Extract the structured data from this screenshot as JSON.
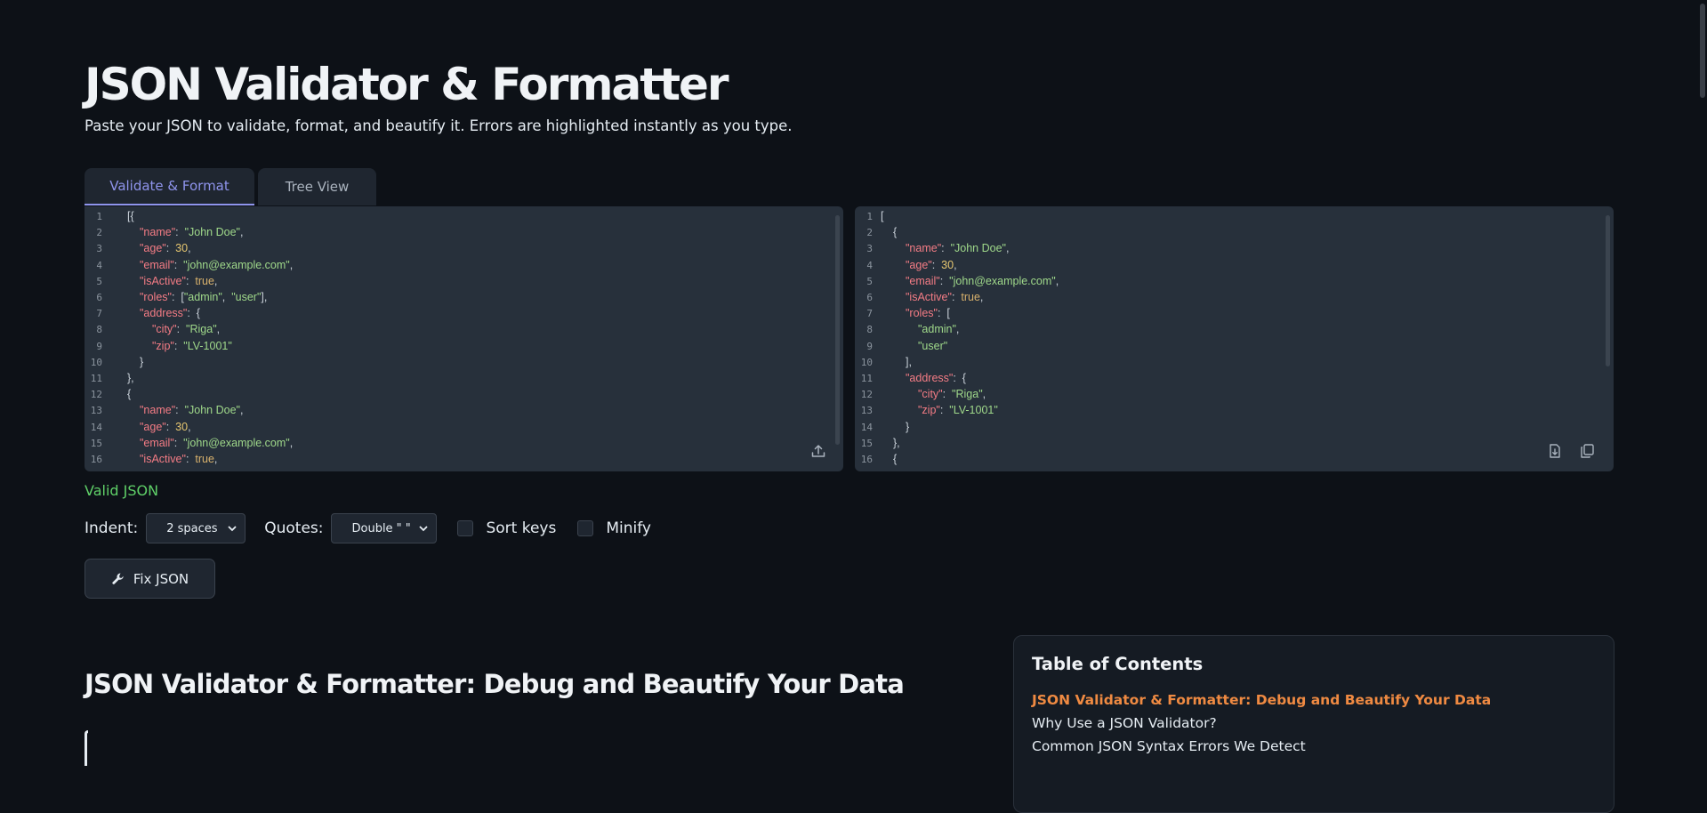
{
  "header": {
    "title": "JSON Validator & Formatter",
    "subtitle": "Paste your JSON to validate, format, and beautify it. Errors are highlighted instantly as you type."
  },
  "tabs": [
    {
      "label": "Validate & Format",
      "active": true
    },
    {
      "label": "Tree View",
      "active": false
    }
  ],
  "status": {
    "text": "Valid JSON",
    "color": "#5fd068"
  },
  "options": {
    "indent_label": "Indent:",
    "indent_value": "2 spaces",
    "quotes_label": "Quotes:",
    "quotes_value": "Double \" \"",
    "sort_keys_label": "Sort keys",
    "minify_label": "Minify"
  },
  "fix_button": {
    "label": "Fix JSON",
    "icon": "wrench-icon"
  },
  "section_heading": "JSON Validator & Formatter: Debug and Beautify Your Data",
  "toc": {
    "title": "Table of Contents",
    "items": [
      {
        "label": "JSON Validator & Formatter: Debug and Beautify Your Data",
        "active": true
      },
      {
        "label": "Why Use a JSON Validator?",
        "active": false
      },
      {
        "label": "Common JSON Syntax Errors We Detect",
        "active": false
      }
    ]
  },
  "input_editor": {
    "line_numbers": [
      "1",
      "2",
      "3",
      "4",
      "5",
      "6",
      "7",
      "8",
      "9",
      "10",
      "11",
      "12",
      "13",
      "14",
      "15",
      "16"
    ],
    "lines": [
      [
        {
          "t": "p",
          "v": "[{"
        }
      ],
      [
        {
          "t": "k",
          "v": "\"name\""
        },
        {
          "t": "p",
          "v": ":  "
        },
        {
          "t": "s",
          "v": "\"John Doe\""
        },
        {
          "t": "p",
          "v": ","
        }
      ],
      [
        {
          "t": "k",
          "v": "\"age\""
        },
        {
          "t": "p",
          "v": ":  "
        },
        {
          "t": "n",
          "v": "30"
        },
        {
          "t": "p",
          "v": ","
        }
      ],
      [
        {
          "t": "k",
          "v": "\"email\""
        },
        {
          "t": "p",
          "v": ":  "
        },
        {
          "t": "s",
          "v": "\"john@example.com\""
        },
        {
          "t": "p",
          "v": ","
        }
      ],
      [
        {
          "t": "k",
          "v": "\"isActive\""
        },
        {
          "t": "p",
          "v": ":  "
        },
        {
          "t": "b",
          "v": "true"
        },
        {
          "t": "p",
          "v": ","
        }
      ],
      [
        {
          "t": "k",
          "v": "\"roles\""
        },
        {
          "t": "p",
          "v": ":  ["
        },
        {
          "t": "s",
          "v": "\"admin\""
        },
        {
          "t": "p",
          "v": ",  "
        },
        {
          "t": "s",
          "v": "\"user\""
        },
        {
          "t": "p",
          "v": "],"
        }
      ],
      [
        {
          "t": "k",
          "v": "\"address\""
        },
        {
          "t": "p",
          "v": ":  {"
        }
      ],
      [
        {
          "t": "k",
          "v": "\"city\""
        },
        {
          "t": "p",
          "v": ":  "
        },
        {
          "t": "s",
          "v": "\"Riga\""
        },
        {
          "t": "p",
          "v": ","
        }
      ],
      [
        {
          "t": "k",
          "v": "\"zip\""
        },
        {
          "t": "p",
          "v": ":  "
        },
        {
          "t": "s",
          "v": "\"LV-1001\""
        }
      ],
      [
        {
          "t": "p",
          "v": "}"
        }
      ],
      [
        {
          "t": "p",
          "v": "},"
        }
      ],
      [
        {
          "t": "p",
          "v": "{"
        }
      ],
      [
        {
          "t": "k",
          "v": "\"name\""
        },
        {
          "t": "p",
          "v": ":  "
        },
        {
          "t": "s",
          "v": "\"John Doe\""
        },
        {
          "t": "p",
          "v": ","
        }
      ],
      [
        {
          "t": "k",
          "v": "\"age\""
        },
        {
          "t": "p",
          "v": ":  "
        },
        {
          "t": "n",
          "v": "30"
        },
        {
          "t": "p",
          "v": ","
        }
      ],
      [
        {
          "t": "k",
          "v": "\"email\""
        },
        {
          "t": "p",
          "v": ":  "
        },
        {
          "t": "s",
          "v": "\"john@example.com\""
        },
        {
          "t": "p",
          "v": ","
        }
      ],
      [
        {
          "t": "k",
          "v": "\"isActive\""
        },
        {
          "t": "p",
          "v": ":  "
        },
        {
          "t": "b",
          "v": "true"
        },
        {
          "t": "p",
          "v": ","
        }
      ]
    ],
    "indent_levels": [
      0,
      1,
      1,
      1,
      1,
      1,
      1,
      2,
      2,
      1,
      0,
      0,
      1,
      1,
      1,
      1
    ],
    "actions": [
      {
        "icon": "upload-icon"
      }
    ]
  },
  "output_editor": {
    "line_numbers": [
      "1",
      "2",
      "3",
      "4",
      "5",
      "6",
      "7",
      "8",
      "9",
      "10",
      "11",
      "12",
      "13",
      "14",
      "15",
      "16"
    ],
    "lines": [
      [
        {
          "t": "p",
          "v": "["
        }
      ],
      [
        {
          "t": "p",
          "v": "{"
        }
      ],
      [
        {
          "t": "k",
          "v": "\"name\""
        },
        {
          "t": "p",
          "v": ":  "
        },
        {
          "t": "s",
          "v": "\"John Doe\""
        },
        {
          "t": "p",
          "v": ","
        }
      ],
      [
        {
          "t": "k",
          "v": "\"age\""
        },
        {
          "t": "p",
          "v": ":  "
        },
        {
          "t": "n",
          "v": "30"
        },
        {
          "t": "p",
          "v": ","
        }
      ],
      [
        {
          "t": "k",
          "v": "\"email\""
        },
        {
          "t": "p",
          "v": ":  "
        },
        {
          "t": "s",
          "v": "\"john@example.com\""
        },
        {
          "t": "p",
          "v": ","
        }
      ],
      [
        {
          "t": "k",
          "v": "\"isActive\""
        },
        {
          "t": "p",
          "v": ":  "
        },
        {
          "t": "b",
          "v": "true"
        },
        {
          "t": "p",
          "v": ","
        }
      ],
      [
        {
          "t": "k",
          "v": "\"roles\""
        },
        {
          "t": "p",
          "v": ":  ["
        }
      ],
      [
        {
          "t": "s",
          "v": "\"admin\""
        },
        {
          "t": "p",
          "v": ","
        }
      ],
      [
        {
          "t": "s",
          "v": "\"user\""
        }
      ],
      [
        {
          "t": "p",
          "v": "],"
        }
      ],
      [
        {
          "t": "k",
          "v": "\"address\""
        },
        {
          "t": "p",
          "v": ":  {"
        }
      ],
      [
        {
          "t": "k",
          "v": "\"city\""
        },
        {
          "t": "p",
          "v": ":  "
        },
        {
          "t": "s",
          "v": "\"Riga\""
        },
        {
          "t": "p",
          "v": ","
        }
      ],
      [
        {
          "t": "k",
          "v": "\"zip\""
        },
        {
          "t": "p",
          "v": ":  "
        },
        {
          "t": "s",
          "v": "\"LV-1001\""
        }
      ],
      [
        {
          "t": "p",
          "v": "}"
        }
      ],
      [
        {
          "t": "p",
          "v": "},"
        }
      ],
      [
        {
          "t": "p",
          "v": "{"
        }
      ]
    ],
    "indent_levels": [
      0,
      1,
      2,
      2,
      2,
      2,
      2,
      3,
      3,
      2,
      2,
      3,
      3,
      2,
      1,
      1
    ],
    "actions": [
      {
        "icon": "download-file-icon"
      },
      {
        "icon": "copy-icon"
      }
    ]
  },
  "colors": {
    "background": "#0d1117",
    "editor_bg": "#27303b",
    "accent": "#8f94ec",
    "key": "#f47c85",
    "string": "#9fd88a",
    "number": "#e7c770",
    "toc_active": "#ef8a42"
  }
}
